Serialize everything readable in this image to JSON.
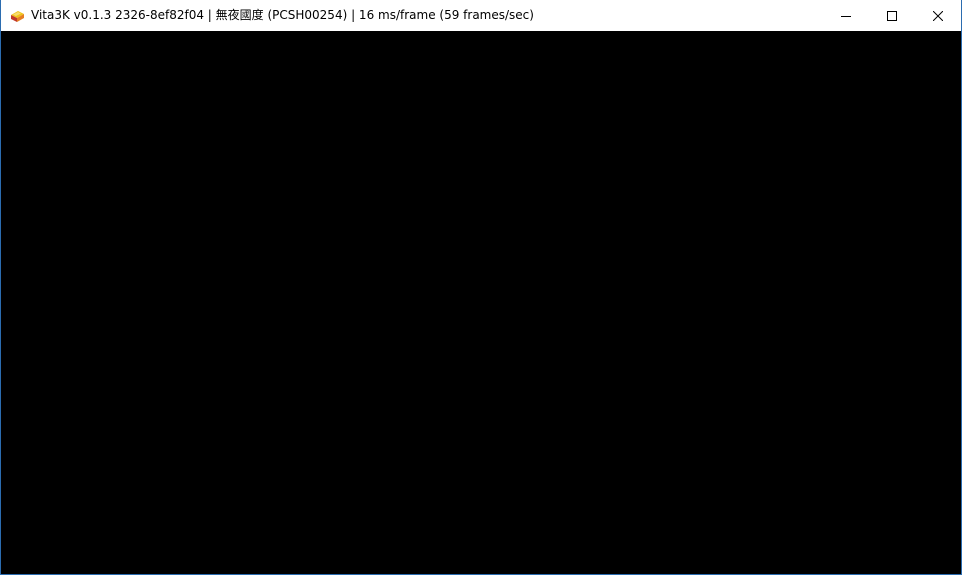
{
  "window": {
    "title": "Vita3K v0.1.3 2326-8ef82f04 | 無夜國度 (PCSH00254) | 16 ms/frame (59 frames/sec)",
    "app_icon": "vita3k-icon",
    "controls": {
      "minimize_icon": "minimize-icon",
      "maximize_icon": "maximize-icon",
      "close_icon": "close-icon"
    }
  },
  "colors": {
    "titlebar_bg": "#ffffff",
    "content_bg": "#000000",
    "border": "#2b6cb0"
  }
}
